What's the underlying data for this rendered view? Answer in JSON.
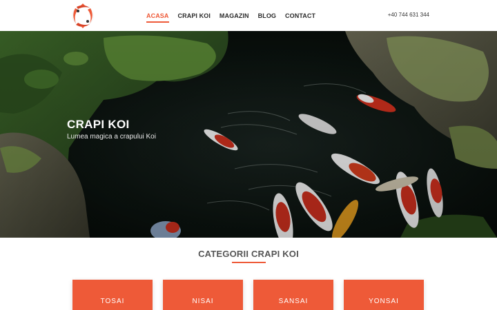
{
  "header": {
    "nav": [
      {
        "label": "ACASA",
        "active": true
      },
      {
        "label": "CRAPI KOI",
        "active": false
      },
      {
        "label": "MAGAZIN",
        "active": false
      },
      {
        "label": "BLOG",
        "active": false
      },
      {
        "label": "CONTACT",
        "active": false
      }
    ],
    "phone": "+40 744 631 344"
  },
  "hero": {
    "title": "CRAPI KOI",
    "subtitle": "Lumea magica a crapului Koi"
  },
  "categories": {
    "title": "CATEGORII CRAPI KOI",
    "items": [
      "TOSAI",
      "NISAI",
      "SANSAI",
      "YONSAI"
    ]
  },
  "colors": {
    "accent": "#ee5a38",
    "text_dark": "#2b2b2b",
    "section_title": "#555555"
  }
}
